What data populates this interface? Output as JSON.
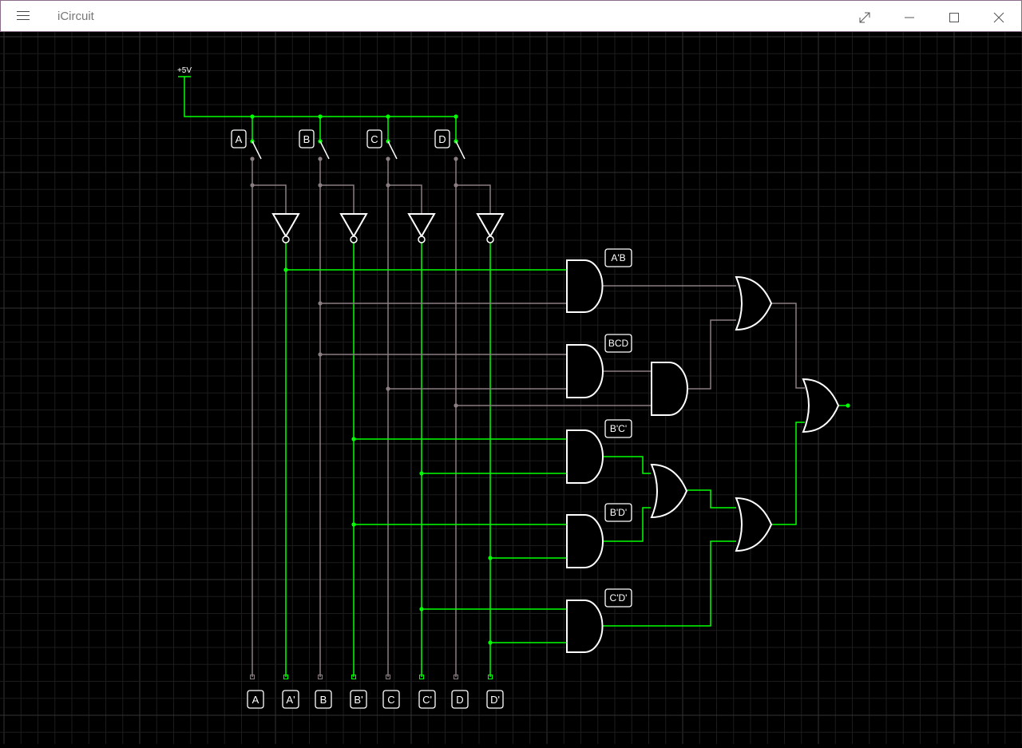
{
  "window": {
    "title": "iCircuit",
    "menu_icon": "hamburger-menu-icon",
    "controls": [
      "fullscreen-icon",
      "minimize-icon",
      "maximize-icon",
      "close-icon"
    ]
  },
  "colors": {
    "background": "#000000",
    "grid_minor": "#1c1c1c",
    "grid_major": "#333333",
    "wire_high": "#00ff00",
    "wire_low": "#8a7e82",
    "gate_outline": "#ffffff",
    "label_border": "#ffffff"
  },
  "circuit": {
    "source_label": "+5V",
    "switches": [
      "A",
      "B",
      "C",
      "D"
    ],
    "gate_labels": [
      "A'B",
      "BCD",
      "B'C'",
      "B'D'",
      "C'D'"
    ],
    "probe_labels": [
      "A",
      "A'",
      "B",
      "B'",
      "C",
      "C'",
      "D",
      "D'"
    ]
  }
}
